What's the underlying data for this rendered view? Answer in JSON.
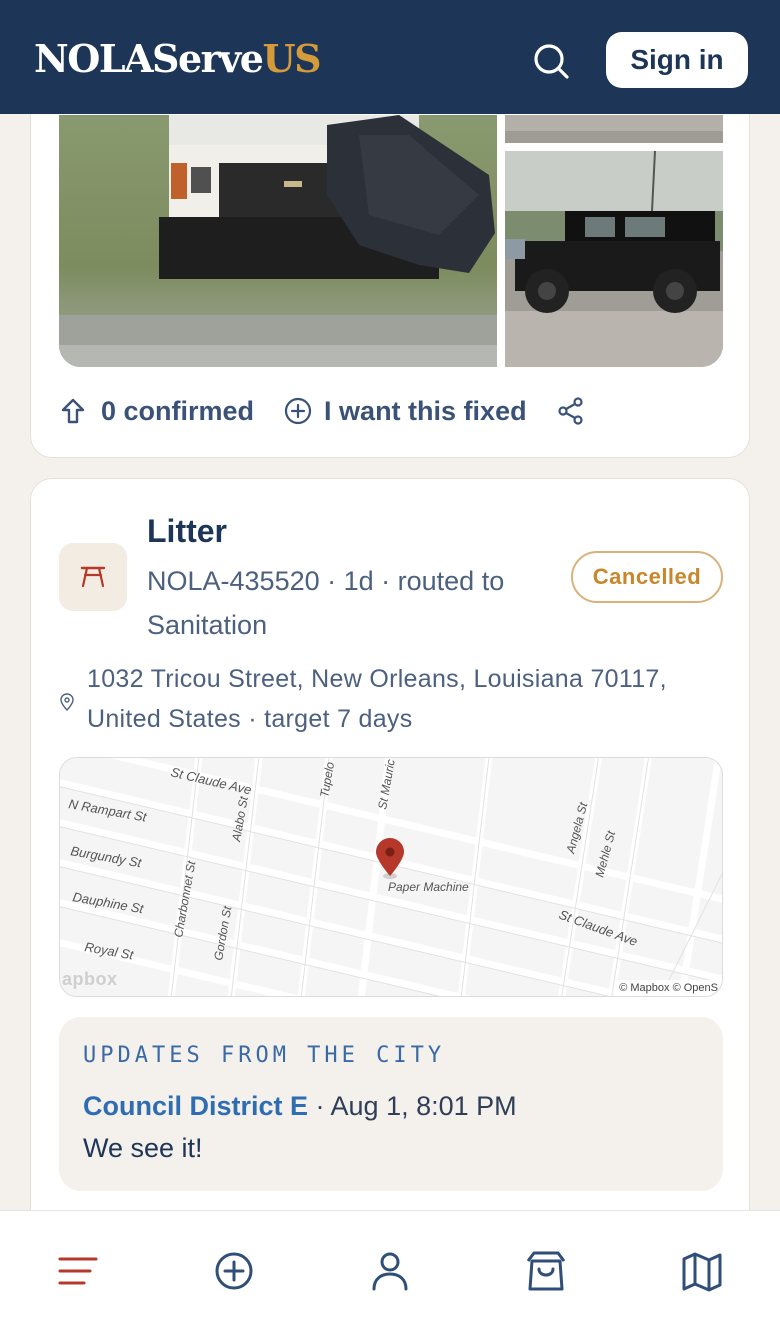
{
  "header": {
    "logo_main": "NOLAServe",
    "logo_accent": "US",
    "sign_in_label": "Sign in"
  },
  "report_previous": {
    "confirmed_label": "0 confirmed",
    "want_fixed_label": "I want this fixed"
  },
  "report": {
    "category": "Litter",
    "meta": "NOLA-435520 · 1d · routed to Sanitation",
    "status": "Cancelled",
    "address": "1032 Tricou Street, New Orleans, Louisiana 70117, United States · target 7 days",
    "map": {
      "streets": [
        "St Claude Ave",
        "N Rampart St",
        "Burgundy St",
        "Dauphine St",
        "Royal St",
        "Charbonnet St",
        "Alabo St",
        "Gordon St",
        "Tupelo",
        "St Mauric",
        "Angela St",
        "Mehle St",
        "St Claude Ave"
      ],
      "poi": "Paper Machine",
      "logo": "apbox",
      "attribution": "© Mapbox © OpenS"
    },
    "updates": {
      "heading": "UPDATES FROM THE CITY",
      "author": "Council District E",
      "time": " · Aug 1, 8:01 PM",
      "message": "We see it!"
    }
  },
  "colors": {
    "header_bg": "#1d3557",
    "accent": "#d59a3a",
    "status_cancelled": "#c9862b",
    "pin": "#b5382a"
  },
  "bottom_nav": [
    "menu-icon",
    "add-circle-icon",
    "user-icon",
    "shopping-bag-icon",
    "map-icon"
  ]
}
